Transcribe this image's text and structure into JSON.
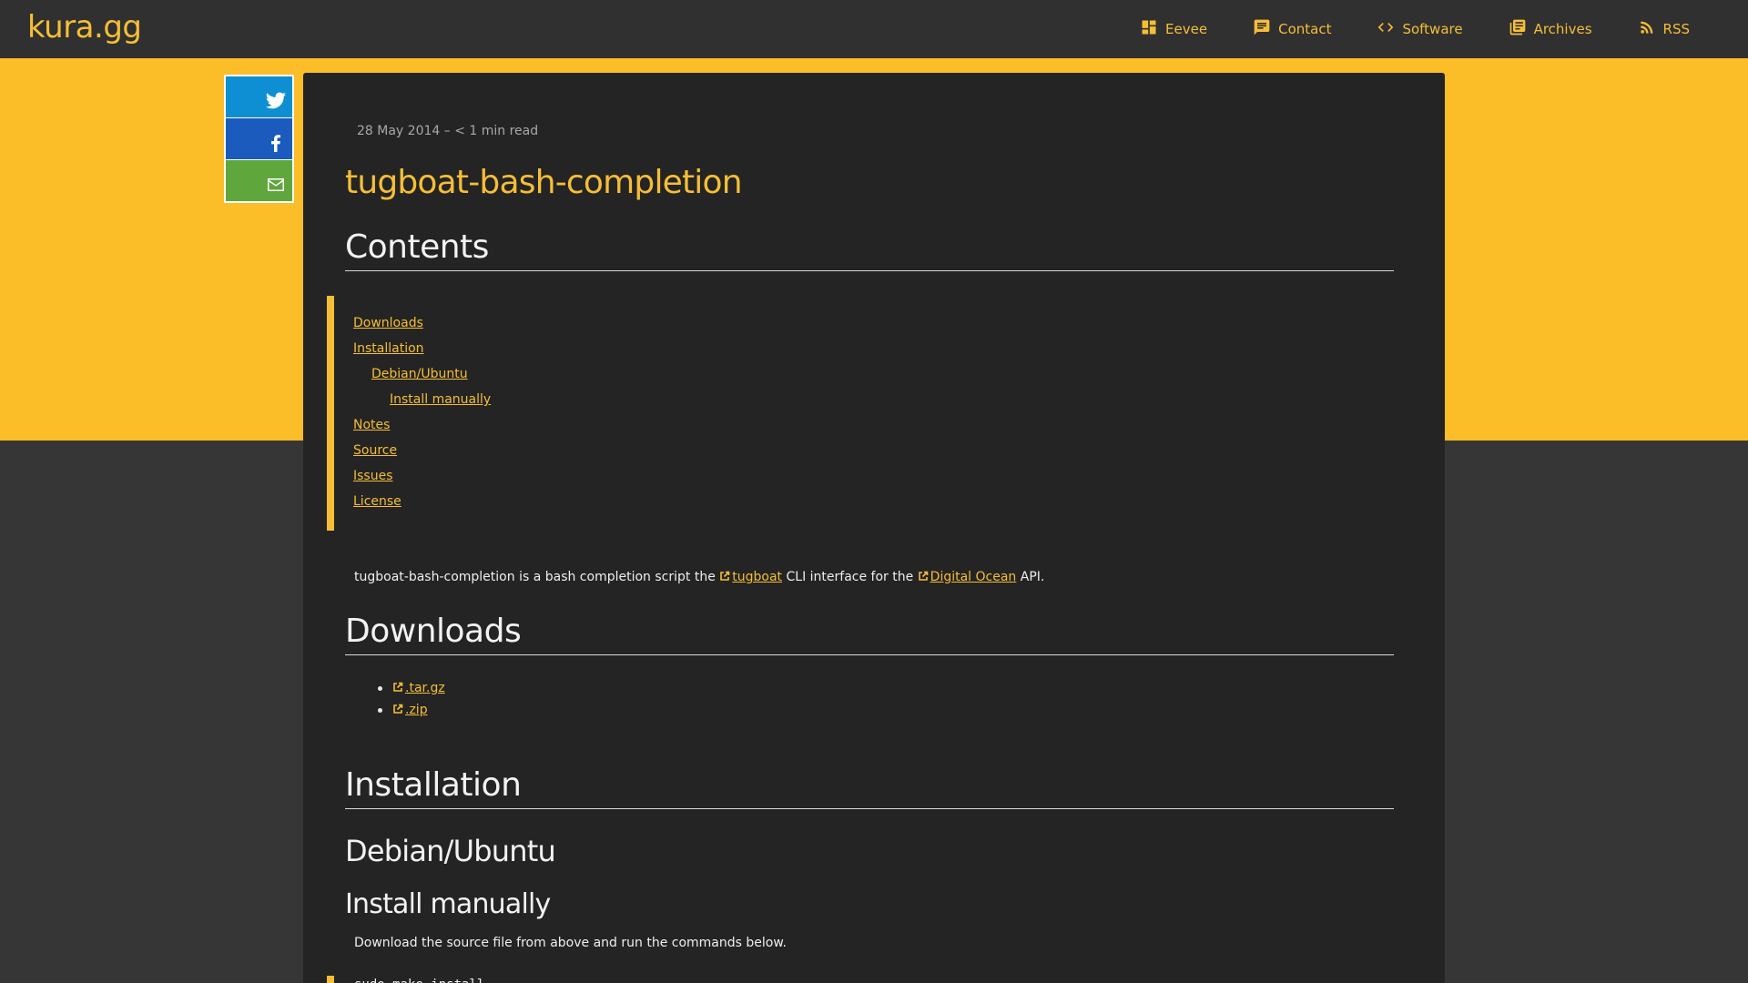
{
  "header": {
    "brand": "kura.gg",
    "nav": [
      {
        "label": "Eevee",
        "icon": "dashboard-icon"
      },
      {
        "label": "Contact",
        "icon": "chat-icon"
      },
      {
        "label": "Software",
        "icon": "code-icon"
      },
      {
        "label": "Archives",
        "icon": "library-icon"
      },
      {
        "label": "RSS",
        "icon": "rss-icon"
      }
    ]
  },
  "share": [
    {
      "name": "twitter",
      "icon": "twitter-icon",
      "color": "#0f8fd3"
    },
    {
      "name": "facebook",
      "icon": "facebook-icon",
      "color": "#1a5bbd"
    },
    {
      "name": "email",
      "icon": "mail-icon",
      "color": "#5fa63c"
    }
  ],
  "article": {
    "meta": "28 May 2014 – < 1 min read",
    "title": "tugboat-bash-completion",
    "contents_heading": "Contents",
    "toc": [
      {
        "label": "Downloads",
        "level": 1
      },
      {
        "label": "Installation",
        "level": 1
      },
      {
        "label": "Debian/Ubuntu",
        "level": 2
      },
      {
        "label": "Install manually",
        "level": 3
      },
      {
        "label": "Notes",
        "level": 1
      },
      {
        "label": "Source",
        "level": 1
      },
      {
        "label": "Issues",
        "level": 1
      },
      {
        "label": "License",
        "level": 1
      }
    ],
    "intro": {
      "before": "tugboat-bash-completion is a bash completion script the ",
      "link1": "tugboat",
      "middle": " CLI interface for the ",
      "link2": "Digital Ocean",
      "after": " API."
    },
    "downloads_heading": "Downloads",
    "downloads": [
      ".tar.gz",
      ".zip"
    ],
    "installation_heading": "Installation",
    "debian_heading": "Debian/Ubuntu",
    "install_manually_heading": "Install manually",
    "install_text": "Download the source file from above and run the commands below.",
    "code": "sudo make install"
  },
  "colors": {
    "accent": "#f5be37",
    "band": "#fbbd28",
    "background": "#363636",
    "article_bg": "#242424",
    "topbar": "#303030"
  }
}
